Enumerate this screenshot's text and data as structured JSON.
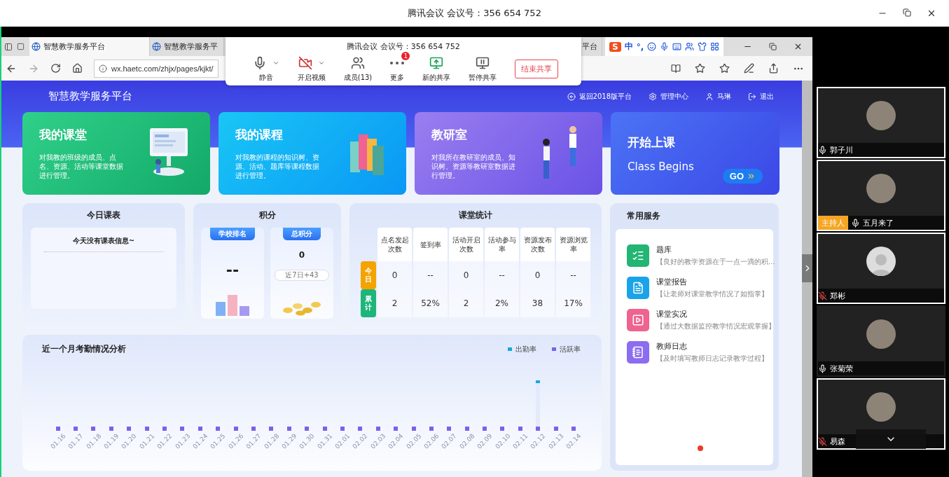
{
  "meeting_window": {
    "title": "腾讯会议 会议号：356 654 752"
  },
  "browser": {
    "tabs": [
      {
        "label": "智慧教学服务平台",
        "selected": true
      },
      {
        "label": "智慧教学服务平",
        "selected": false
      },
      {
        "label": "平台",
        "selected": false
      }
    ],
    "ime": {
      "logo": "S",
      "mode": "中",
      "punctuation": "°,"
    },
    "address": "wx.haetc.com/zhjx/pages/kjkt/"
  },
  "share_toolbar": {
    "title": "腾讯会议 会议号：356 654 752",
    "buttons": [
      {
        "kind": "mic",
        "label": "静音",
        "dropdown": true
      },
      {
        "kind": "video",
        "label": "开启视频",
        "dropdown": true
      },
      {
        "kind": "members",
        "label": "成员(13)",
        "dropdown": false
      },
      {
        "kind": "more",
        "label": "更多",
        "dropdown": false,
        "badge": "1"
      },
      {
        "kind": "new_share",
        "label": "新的共享",
        "dropdown": false
      },
      {
        "kind": "pause_share",
        "label": "暂停共享",
        "dropdown": false
      }
    ],
    "end_button": "结束共享"
  },
  "header": {
    "title": "智慧教学服务平台",
    "links": [
      {
        "kind": "back",
        "label": "返回2018版平台"
      },
      {
        "kind": "admin",
        "label": "管理中心"
      },
      {
        "kind": "user",
        "label": "马琳"
      },
      {
        "kind": "logout",
        "label": "退出"
      }
    ]
  },
  "feature_cards": [
    {
      "kind": "classroom",
      "title": "我的课堂",
      "description": "对我教的班级的成员、点名、资源、活动等课堂数据进行管理。"
    },
    {
      "kind": "courses",
      "title": "我的课程",
      "description": "对我教的课程的知识树、资源、活动、题库等课程数据进行管理。"
    },
    {
      "kind": "research",
      "title": "教研室",
      "description": "对我所在教研室的成员、知识树、资源等教研室数据进行管理。"
    },
    {
      "kind": "start",
      "title": "开始上课",
      "subtitle": "Class Begins",
      "button": "GO"
    }
  ],
  "schedule": {
    "title": "今日课表",
    "message": "今天没有课表信息~"
  },
  "points": {
    "title": "积分",
    "ranking": {
      "label": "学校排名",
      "value": "--"
    },
    "total": {
      "label": "总积分",
      "value": "0",
      "recent": "近7日+43"
    }
  },
  "class_stats": {
    "title": "课堂统计",
    "columns": [
      "点名发起次数",
      "签到率",
      "活动开启次数",
      "活动参与率",
      "资源发布次数",
      "资源浏览率"
    ],
    "rows": [
      {
        "label": "今日",
        "color": "#f5a300",
        "values": [
          "0",
          "--",
          "0",
          "--",
          "0",
          "--"
        ]
      },
      {
        "label": "累计",
        "color": "#1db57a",
        "values": [
          "2",
          "52%",
          "2",
          "2%",
          "38",
          "17%"
        ]
      }
    ]
  },
  "attendance": {
    "title": "近一个月考勤情况分析",
    "legend": [
      {
        "label": "出勤率",
        "color": "#1aa6e0"
      },
      {
        "label": "活跃率",
        "color": "#7b61e8"
      }
    ],
    "dates": [
      {
        "label": "01.16",
        "kind": "flat"
      },
      {
        "label": "01.17",
        "kind": "flat"
      },
      {
        "label": "01.18",
        "kind": "flat"
      },
      {
        "label": "01.19",
        "kind": "flat"
      },
      {
        "label": "01.20",
        "kind": "flat"
      },
      {
        "label": "01.21",
        "kind": "flat"
      },
      {
        "label": "01.22",
        "kind": "flat"
      },
      {
        "label": "01.23",
        "kind": "flat"
      },
      {
        "label": "01.24",
        "kind": "flat"
      },
      {
        "label": "01.25",
        "kind": "flat"
      },
      {
        "label": "01.26",
        "kind": "flat"
      },
      {
        "label": "01.27",
        "kind": "flat"
      },
      {
        "label": "01.28",
        "kind": "flat"
      },
      {
        "label": "01.29",
        "kind": "flat"
      },
      {
        "label": "01.30",
        "kind": "flat"
      },
      {
        "label": "01.31",
        "kind": "flat"
      },
      {
        "label": "02.01",
        "kind": "flat"
      },
      {
        "label": "02.02",
        "kind": "flat"
      },
      {
        "label": "02.03",
        "kind": "flat"
      },
      {
        "label": "02.04",
        "kind": "flat"
      },
      {
        "label": "02.05",
        "kind": "flat"
      },
      {
        "label": "02.06",
        "kind": "flat"
      },
      {
        "label": "02.07",
        "kind": "flat"
      },
      {
        "label": "02.08",
        "kind": "flat"
      },
      {
        "label": "02.09",
        "kind": "flat"
      },
      {
        "label": "02.10",
        "kind": "flat"
      },
      {
        "label": "02.11",
        "kind": "flat"
      },
      {
        "label": "02.12",
        "kind": "spike"
      },
      {
        "label": "02.13",
        "kind": "flat"
      },
      {
        "label": "02.14",
        "kind": "flat"
      }
    ]
  },
  "services": {
    "title": "常用服务",
    "items": [
      {
        "kind": "question_bank",
        "title": "题库",
        "description": "【良好的教学资源在于一点一滴的积...",
        "color": "#22b573"
      },
      {
        "kind": "report",
        "title": "课堂报告",
        "description": "【让老师对课堂教学情况了如指掌】",
        "color": "#1aa3e8"
      },
      {
        "kind": "live",
        "title": "课堂实况",
        "description": "【通过大数据监控教学情况宏观掌握】",
        "color": "#f0628f"
      },
      {
        "kind": "log",
        "title": "教师日志",
        "description": "【及时填写教师日志记录教学过程】",
        "color": "#8c6cf0"
      }
    ]
  },
  "participants": [
    {
      "name": "郭子川",
      "muted": false,
      "selected": true,
      "kind": "photo"
    },
    {
      "name": "五月来了",
      "muted": false,
      "selected": true,
      "kind": "photo",
      "role": "主持人"
    },
    {
      "name": "郑彬",
      "muted": true,
      "selected": true,
      "kind": "default"
    },
    {
      "name": "张菊荣",
      "muted": false,
      "selected": false,
      "kind": "photo"
    },
    {
      "name": "易森",
      "muted": true,
      "selected": true,
      "kind": "photo"
    }
  ]
}
